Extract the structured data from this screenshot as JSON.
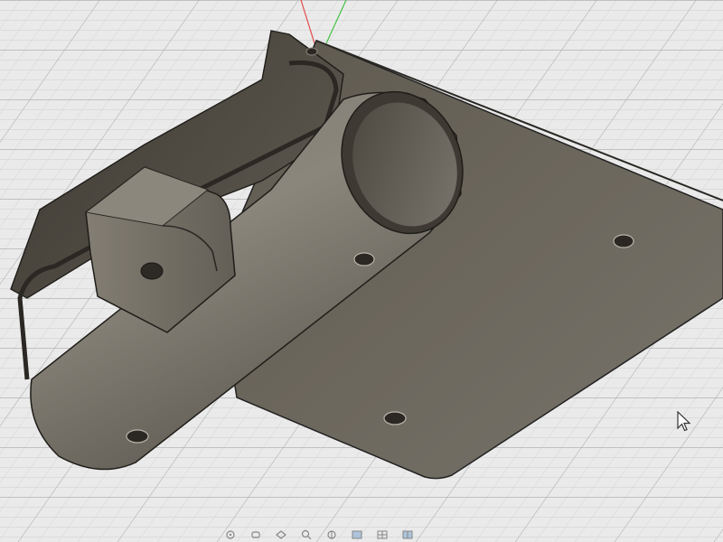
{
  "viewport": {
    "name": "3d-modeling-viewport",
    "background_color": "#eaeaea",
    "grid_color": "#b9bbbb",
    "model_color": "#6f6a5e",
    "x_axis_color": "#e14b4b",
    "y_axis_color": "#43c043"
  },
  "toolbar": {
    "buttons": [
      {
        "name": "orbit-icon"
      },
      {
        "name": "pan-icon"
      },
      {
        "name": "look-at-icon"
      },
      {
        "name": "zoom-window-icon"
      },
      {
        "name": "fit-view-icon"
      },
      {
        "name": "display-settings-icon"
      },
      {
        "name": "grid-settings-icon"
      },
      {
        "name": "viewports-icon"
      }
    ]
  },
  "cursor": {
    "name": "mouse-pointer-icon"
  }
}
